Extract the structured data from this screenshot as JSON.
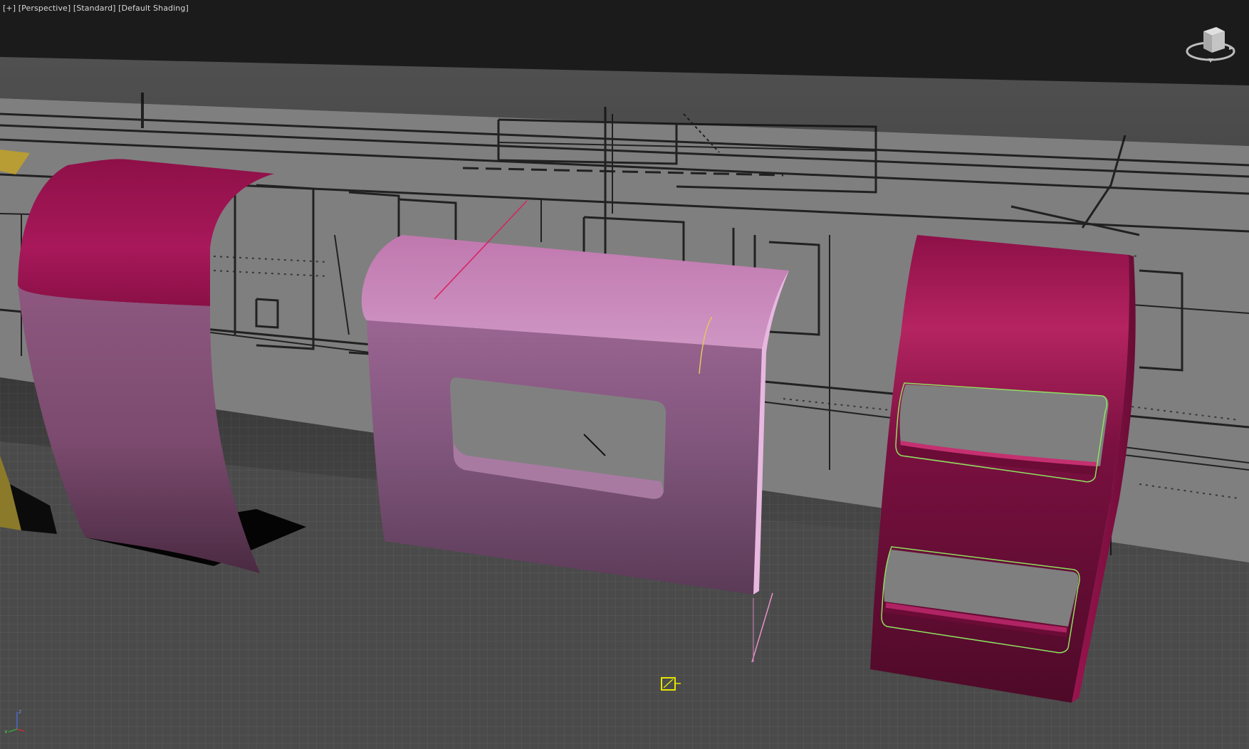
{
  "viewport": {
    "menu_label": "[+]",
    "view_label": "[Perspective]",
    "style_label": "[Standard]",
    "shading_label": "[Default Shading]"
  },
  "icons": {
    "viewcube": "viewcube-icon",
    "axis_tripod": "axis-tripod-icon",
    "pivot": "pivot-gizmo-icon"
  },
  "colors": {
    "viewport_bg": "#1b1b1b",
    "grid_floor": "#4b4b4b",
    "backdrop_plane": "#808080",
    "shape_dark_magenta": "#9c1450",
    "shape_light_pink": "#c882b8",
    "selection_green": "#8fe060",
    "gizmo_yellow": "#e6e600",
    "side_object_gold": "#b09a3a"
  }
}
